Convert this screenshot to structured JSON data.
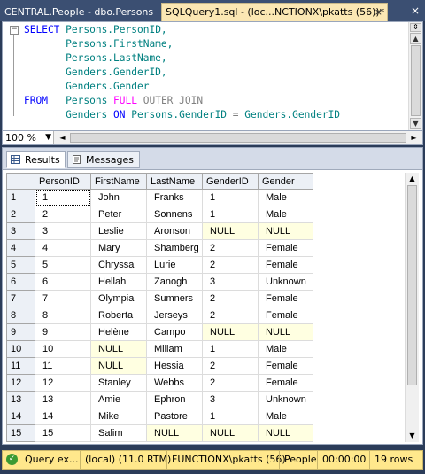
{
  "window": {
    "tabs": [
      {
        "label": "CENTRAL.People - dbo.Persons"
      },
      {
        "label": "SQLQuery1.sql - (loc...NCTIONX\\pkatts (56))*",
        "close": "×"
      }
    ],
    "close_glyph": "×"
  },
  "editor": {
    "lines": [
      [
        {
          "t": "SELECT",
          "c": "kw"
        },
        {
          "t": " Persons.PersonID,",
          "c": "id"
        }
      ],
      [
        {
          "t": "       Persons.FirstName,",
          "c": "id"
        }
      ],
      [
        {
          "t": "       Persons.LastName,",
          "c": "id"
        }
      ],
      [
        {
          "t": "       Genders.GenderID,",
          "c": "id"
        }
      ],
      [
        {
          "t": "       Genders.Gender",
          "c": "id"
        }
      ],
      [
        {
          "t": "FROM",
          "c": "kw"
        },
        {
          "t": "   Persons ",
          "c": "id"
        },
        {
          "t": "FULL",
          "c": "kw2"
        },
        {
          "t": " OUTER JOIN",
          "c": "gray"
        }
      ],
      [
        {
          "t": "       Genders ",
          "c": "id"
        },
        {
          "t": "ON",
          "c": "kw"
        },
        {
          "t": " Persons.GenderID ",
          "c": "id"
        },
        {
          "t": "=",
          "c": "gray"
        },
        {
          "t": " Genders.GenderID",
          "c": "id"
        }
      ]
    ],
    "zoom": "100 %"
  },
  "results": {
    "tabs": {
      "results": "Results",
      "messages": "Messages"
    },
    "columns": [
      "PersonID",
      "FirstName",
      "LastName",
      "GenderID",
      "Gender"
    ],
    "rows": [
      [
        "1",
        "1",
        "John",
        "Franks",
        "1",
        "Male"
      ],
      [
        "2",
        "2",
        "Peter",
        "Sonnens",
        "1",
        "Male"
      ],
      [
        "3",
        "3",
        "Leslie",
        "Aronson",
        "NULL",
        "NULL"
      ],
      [
        "4",
        "4",
        "Mary",
        "Shamberg",
        "2",
        "Female"
      ],
      [
        "5",
        "5",
        "Chryssa",
        "Lurie",
        "2",
        "Female"
      ],
      [
        "6",
        "6",
        "Hellah",
        "Zanogh",
        "3",
        "Unknown"
      ],
      [
        "7",
        "7",
        "Olympia",
        "Sumners",
        "2",
        "Female"
      ],
      [
        "8",
        "8",
        "Roberta",
        "Jerseys",
        "2",
        "Female"
      ],
      [
        "9",
        "9",
        "Helène",
        "Campo",
        "NULL",
        "NULL"
      ],
      [
        "10",
        "10",
        "NULL",
        "Millam",
        "1",
        "Male"
      ],
      [
        "11",
        "11",
        "NULL",
        "Hessia",
        "2",
        "Female"
      ],
      [
        "12",
        "12",
        "Stanley",
        "Webbs",
        "2",
        "Female"
      ],
      [
        "13",
        "13",
        "Amie",
        "Ephron",
        "3",
        "Unknown"
      ],
      [
        "14",
        "14",
        "Mike",
        "Pastore",
        "1",
        "Male"
      ],
      [
        "15",
        "15",
        "Salim",
        "NULL",
        "NULL",
        "NULL"
      ]
    ]
  },
  "status": {
    "message": "Query ex...",
    "server": "(local) (11.0 RTM)",
    "user": "FUNCTIONX\\pkatts (56)",
    "database": "People",
    "elapsed": "00:00:00",
    "rows": "19 rows"
  },
  "colors": {
    "accent_tab": "#fbe7b3",
    "status_bar": "#ffe88c",
    "null_cell": "#ffffe1"
  }
}
